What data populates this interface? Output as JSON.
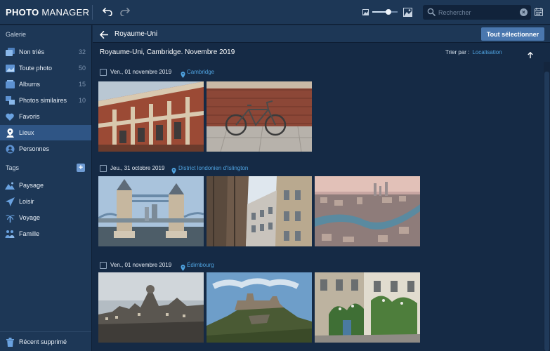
{
  "app": {
    "brand_bold": "PHOTO",
    "brand_light": "MANAGER"
  },
  "toolbar": {
    "undo_icon": "undo-icon",
    "redo_icon": "redo-icon",
    "zoom": {
      "level": 0.63
    },
    "search_placeholder": "Rechercher",
    "search_value": ""
  },
  "sidebar": {
    "galerie_title": "Galerie",
    "items": [
      {
        "label": "Non triés",
        "count": "32",
        "icon": "unsorted-icon"
      },
      {
        "label": "Toute photo",
        "count": "50",
        "icon": "photo-icon"
      },
      {
        "label": "Albums",
        "count": "15",
        "icon": "album-icon"
      },
      {
        "label": "Photos similaires",
        "count": "10",
        "icon": "similar-icon"
      },
      {
        "label": "Favoris",
        "count": "",
        "icon": "heart-icon"
      },
      {
        "label": "Lieux",
        "count": "",
        "icon": "location-icon",
        "active": true
      },
      {
        "label": "Personnes",
        "count": "",
        "icon": "person-icon"
      }
    ],
    "tags_title": "Tags",
    "add_tag": "+",
    "tags": [
      {
        "label": "Paysage",
        "icon": "mountain-icon"
      },
      {
        "label": "Loisir",
        "icon": "plane-icon"
      },
      {
        "label": "Voyage",
        "icon": "palm-icon"
      },
      {
        "label": "Famille",
        "icon": "family-icon"
      }
    ],
    "trash": {
      "label": "Récent supprimé",
      "icon": "trash-icon"
    }
  },
  "header": {
    "title": "Royaume-Uni",
    "select_all": "Tout sélectionner"
  },
  "main": {
    "title": "Royaume-Uni, Cambridge. Novembre 2019",
    "sort_label": "Trier par :",
    "sort_value": "Localisation",
    "groups": [
      {
        "date": "Ven., 01 novembre 2019",
        "location": "Cambridge",
        "photos": [
          "brick-building",
          "bicycle"
        ]
      },
      {
        "date": "Jeu., 31 octobre 2019",
        "location": "District londonien d'Islington",
        "photos": [
          "tower-bridge",
          "london-street",
          "london-aerial"
        ]
      },
      {
        "date": "Ven., 01 novembre 2019",
        "location": "Édimbourg",
        "photos": [
          "edinburgh-skyline",
          "edinburgh-castle",
          "edinburgh-street"
        ]
      }
    ]
  },
  "colors": {
    "accent": "#4fa3e0",
    "button": "#4a77ae",
    "sidebar_active": "#2f5585",
    "background": "#152a45"
  }
}
